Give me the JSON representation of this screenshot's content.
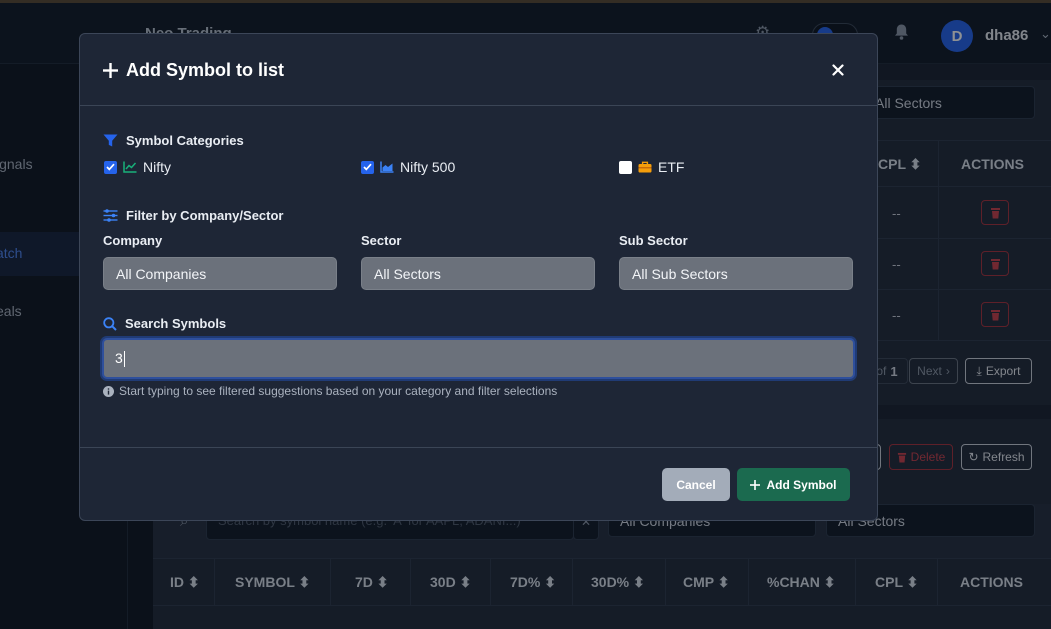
{
  "app": {
    "brand": "Neo Trading",
    "user": {
      "initial": "D",
      "name": "dha86"
    },
    "sidebar": [
      {
        "label": "Signals",
        "visible_text": "ignals",
        "active": false
      },
      {
        "label": "Watch",
        "visible_text": "atch",
        "active": true
      },
      {
        "label": "Deals",
        "visible_text": "eals",
        "active": false
      }
    ],
    "top_panel": {
      "sector_filter": "All Sectors",
      "visible_headers": [
        "CPL",
        "ACTIONS"
      ],
      "rows": [
        {
          "cpl": "--"
        },
        {
          "cpl": "--"
        },
        {
          "cpl": "--"
        }
      ],
      "pagination_of": "of",
      "pagination_total": "1",
      "next_label": "Next",
      "export_label": "Export"
    },
    "bottom_panel": {
      "delete_label": "Delete",
      "refresh_label": "Refresh",
      "search_placeholder": "Search by symbol name (e.g. 'A' for AAPL, ADANI...)",
      "company_filter": "All Companies",
      "sector_filter": "All Sectors",
      "headers": [
        "ID",
        "SYMBOL",
        "7D",
        "30D",
        "7D%",
        "30D%",
        "CMP",
        "%CHAN",
        "CPL",
        "ACTIONS"
      ]
    }
  },
  "modal": {
    "title": "Add Symbol to list",
    "categories": {
      "heading": "Symbol Categories",
      "items": [
        {
          "label": "Nifty",
          "checked": true,
          "icon": "line-chart-icon"
        },
        {
          "label": "Nifty 500",
          "checked": true,
          "icon": "area-chart-icon"
        },
        {
          "label": "ETF",
          "checked": false,
          "icon": "briefcase-icon"
        }
      ]
    },
    "filter": {
      "heading": "Filter by Company/Sector",
      "company_label": "Company",
      "company_value": "All Companies",
      "sector_label": "Sector",
      "sector_value": "All Sectors",
      "subsector_label": "Sub Sector",
      "subsector_value": "All Sub Sectors"
    },
    "search": {
      "heading": "Search Symbols",
      "value": "3",
      "hint": "Start typing to see filtered suggestions based on your category and filter selections"
    },
    "buttons": {
      "cancel": "Cancel",
      "add": "Add Symbol"
    }
  },
  "colors": {
    "accent": "#2563eb",
    "danger": "#c9414c",
    "success": "#1b6a4f"
  }
}
